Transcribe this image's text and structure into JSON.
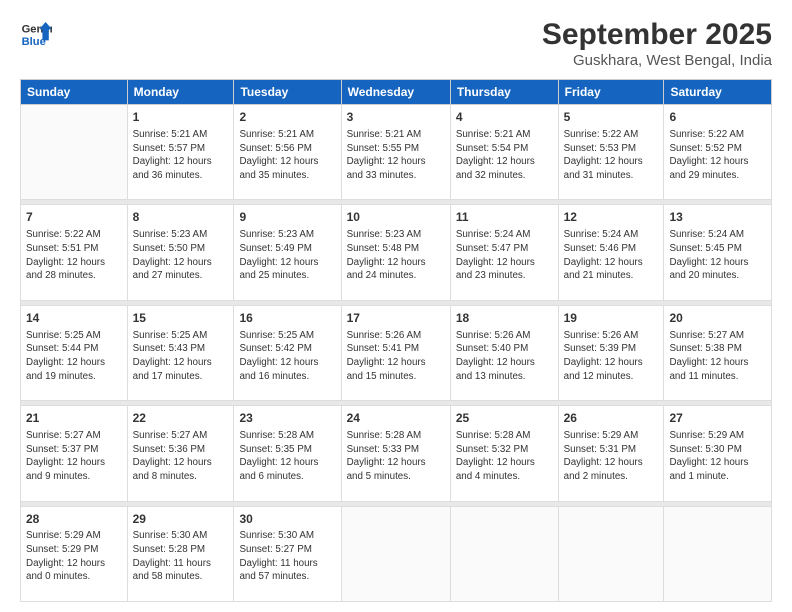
{
  "header": {
    "logo_line1": "General",
    "logo_line2": "Blue",
    "title": "September 2025",
    "location": "Guskhara, West Bengal, India"
  },
  "days_of_week": [
    "Sunday",
    "Monday",
    "Tuesday",
    "Wednesday",
    "Thursday",
    "Friday",
    "Saturday"
  ],
  "weeks": [
    [
      {
        "day": "",
        "info": ""
      },
      {
        "day": "1",
        "info": "Sunrise: 5:21 AM\nSunset: 5:57 PM\nDaylight: 12 hours\nand 36 minutes."
      },
      {
        "day": "2",
        "info": "Sunrise: 5:21 AM\nSunset: 5:56 PM\nDaylight: 12 hours\nand 35 minutes."
      },
      {
        "day": "3",
        "info": "Sunrise: 5:21 AM\nSunset: 5:55 PM\nDaylight: 12 hours\nand 33 minutes."
      },
      {
        "day": "4",
        "info": "Sunrise: 5:21 AM\nSunset: 5:54 PM\nDaylight: 12 hours\nand 32 minutes."
      },
      {
        "day": "5",
        "info": "Sunrise: 5:22 AM\nSunset: 5:53 PM\nDaylight: 12 hours\nand 31 minutes."
      },
      {
        "day": "6",
        "info": "Sunrise: 5:22 AM\nSunset: 5:52 PM\nDaylight: 12 hours\nand 29 minutes."
      }
    ],
    [
      {
        "day": "7",
        "info": "Sunrise: 5:22 AM\nSunset: 5:51 PM\nDaylight: 12 hours\nand 28 minutes."
      },
      {
        "day": "8",
        "info": "Sunrise: 5:23 AM\nSunset: 5:50 PM\nDaylight: 12 hours\nand 27 minutes."
      },
      {
        "day": "9",
        "info": "Sunrise: 5:23 AM\nSunset: 5:49 PM\nDaylight: 12 hours\nand 25 minutes."
      },
      {
        "day": "10",
        "info": "Sunrise: 5:23 AM\nSunset: 5:48 PM\nDaylight: 12 hours\nand 24 minutes."
      },
      {
        "day": "11",
        "info": "Sunrise: 5:24 AM\nSunset: 5:47 PM\nDaylight: 12 hours\nand 23 minutes."
      },
      {
        "day": "12",
        "info": "Sunrise: 5:24 AM\nSunset: 5:46 PM\nDaylight: 12 hours\nand 21 minutes."
      },
      {
        "day": "13",
        "info": "Sunrise: 5:24 AM\nSunset: 5:45 PM\nDaylight: 12 hours\nand 20 minutes."
      }
    ],
    [
      {
        "day": "14",
        "info": "Sunrise: 5:25 AM\nSunset: 5:44 PM\nDaylight: 12 hours\nand 19 minutes."
      },
      {
        "day": "15",
        "info": "Sunrise: 5:25 AM\nSunset: 5:43 PM\nDaylight: 12 hours\nand 17 minutes."
      },
      {
        "day": "16",
        "info": "Sunrise: 5:25 AM\nSunset: 5:42 PM\nDaylight: 12 hours\nand 16 minutes."
      },
      {
        "day": "17",
        "info": "Sunrise: 5:26 AM\nSunset: 5:41 PM\nDaylight: 12 hours\nand 15 minutes."
      },
      {
        "day": "18",
        "info": "Sunrise: 5:26 AM\nSunset: 5:40 PM\nDaylight: 12 hours\nand 13 minutes."
      },
      {
        "day": "19",
        "info": "Sunrise: 5:26 AM\nSunset: 5:39 PM\nDaylight: 12 hours\nand 12 minutes."
      },
      {
        "day": "20",
        "info": "Sunrise: 5:27 AM\nSunset: 5:38 PM\nDaylight: 12 hours\nand 11 minutes."
      }
    ],
    [
      {
        "day": "21",
        "info": "Sunrise: 5:27 AM\nSunset: 5:37 PM\nDaylight: 12 hours\nand 9 minutes."
      },
      {
        "day": "22",
        "info": "Sunrise: 5:27 AM\nSunset: 5:36 PM\nDaylight: 12 hours\nand 8 minutes."
      },
      {
        "day": "23",
        "info": "Sunrise: 5:28 AM\nSunset: 5:35 PM\nDaylight: 12 hours\nand 6 minutes."
      },
      {
        "day": "24",
        "info": "Sunrise: 5:28 AM\nSunset: 5:33 PM\nDaylight: 12 hours\nand 5 minutes."
      },
      {
        "day": "25",
        "info": "Sunrise: 5:28 AM\nSunset: 5:32 PM\nDaylight: 12 hours\nand 4 minutes."
      },
      {
        "day": "26",
        "info": "Sunrise: 5:29 AM\nSunset: 5:31 PM\nDaylight: 12 hours\nand 2 minutes."
      },
      {
        "day": "27",
        "info": "Sunrise: 5:29 AM\nSunset: 5:30 PM\nDaylight: 12 hours\nand 1 minute."
      }
    ],
    [
      {
        "day": "28",
        "info": "Sunrise: 5:29 AM\nSunset: 5:29 PM\nDaylight: 12 hours\nand 0 minutes."
      },
      {
        "day": "29",
        "info": "Sunrise: 5:30 AM\nSunset: 5:28 PM\nDaylight: 11 hours\nand 58 minutes."
      },
      {
        "day": "30",
        "info": "Sunrise: 5:30 AM\nSunset: 5:27 PM\nDaylight: 11 hours\nand 57 minutes."
      },
      {
        "day": "",
        "info": ""
      },
      {
        "day": "",
        "info": ""
      },
      {
        "day": "",
        "info": ""
      },
      {
        "day": "",
        "info": ""
      }
    ]
  ]
}
